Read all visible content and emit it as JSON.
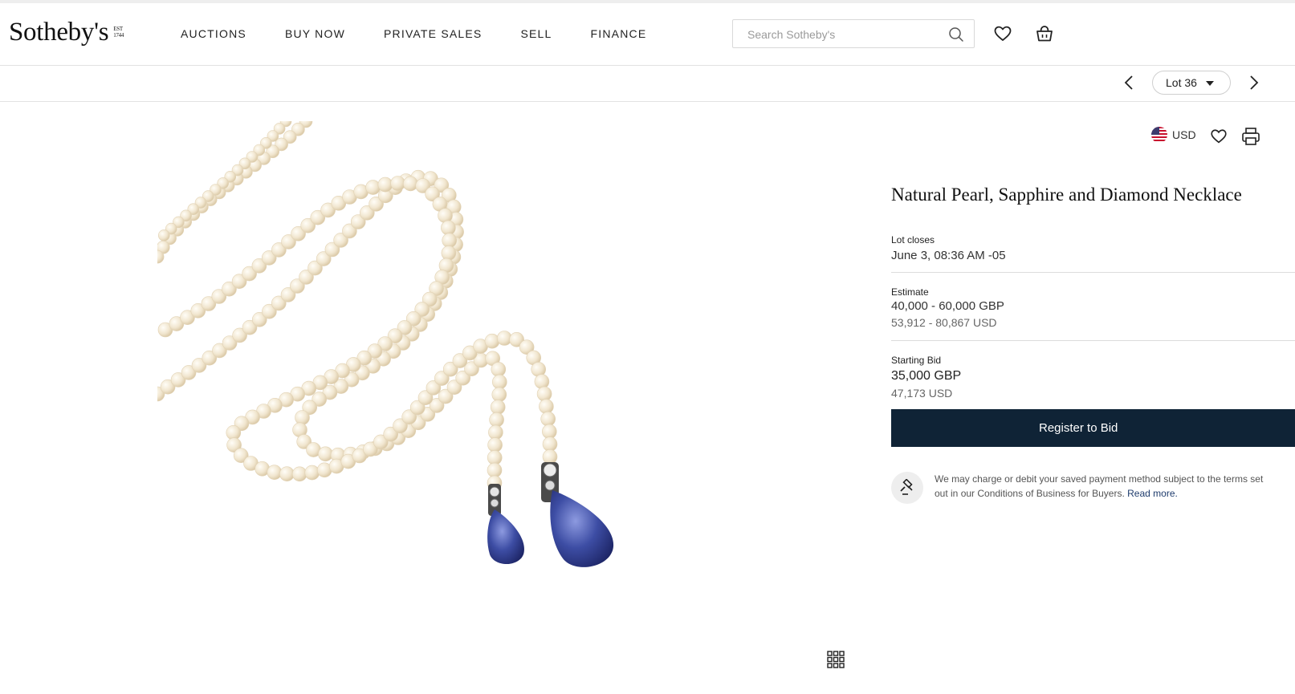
{
  "header": {
    "logo": "Sotheby's",
    "logo_est_lines": [
      "EST",
      "1744"
    ],
    "nav": [
      "AUCTIONS",
      "BUY NOW",
      "PRIVATE SALES",
      "SELL",
      "FINANCE"
    ],
    "search_placeholder": "Search Sotheby's",
    "icons": [
      "search-icon",
      "heart-icon",
      "shopping-bag-icon"
    ]
  },
  "lot_bar": {
    "lot_label": "Lot 36"
  },
  "tools": {
    "currency": "USD"
  },
  "lot": {
    "title": "Natural Pearl, Sapphire and Diamond Necklace",
    "lot_closes_label": "Lot closes",
    "lot_closes_value": "June 3, 08:36 AM -05",
    "estimate_label": "Estimate",
    "estimate_gbp": "40,000 - 60,000 GBP",
    "estimate_usd": "53,912 - 80,867 USD",
    "starting_bid_label": "Starting Bid",
    "starting_bid_gbp": "35,000 GBP",
    "starting_bid_usd": "47,173 USD",
    "register_button": "Register to Bid",
    "notice_text_1": "We may charge or debit your saved payment method subject to the terms set",
    "notice_text_2": "out in our Conditions of Business for Buyers.",
    "notice_link": "Read more."
  },
  "colors": {
    "register_bg": "#0f2336",
    "link": "#1f3c6d",
    "pearl": "#f3e9d6",
    "sapphire": "#3b4f9e"
  }
}
